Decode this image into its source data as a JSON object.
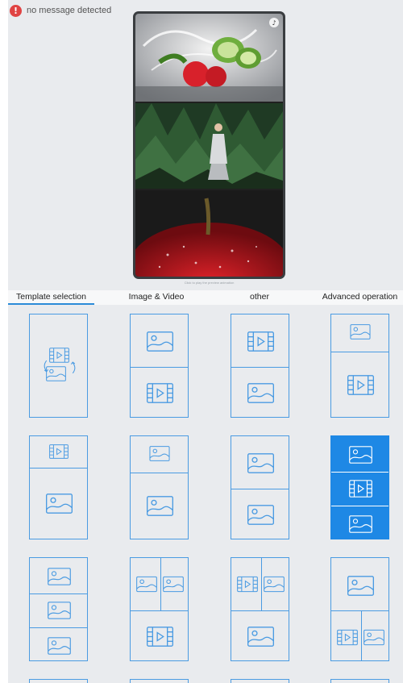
{
  "status": {
    "message": "no message detected",
    "icon": "error-icon",
    "color": "#e04343"
  },
  "preview": {
    "caption": "Click to play the preview animation",
    "panes": [
      "vegetable-splash-photo",
      "woman-in-forest-photo",
      "red-apple-photo"
    ],
    "music_icon": "music-note-icon"
  },
  "tabs": [
    {
      "label": "Template selection",
      "active": true
    },
    {
      "label": "Image & Video",
      "active": false
    },
    {
      "label": "other",
      "active": false
    },
    {
      "label": "Advanced operation",
      "active": false
    }
  ],
  "templates": {
    "accent": "#1e88e5",
    "selected_index": 7,
    "items": [
      {
        "layout": "swap-video-image"
      },
      {
        "layout": "image-over-video"
      },
      {
        "layout": "video-over-image"
      },
      {
        "layout": "image-over-video-small-top"
      },
      {
        "layout": "video-top-small-image-bottom"
      },
      {
        "layout": "image-top-small-image-bottom"
      },
      {
        "layout": "image-over-image"
      },
      {
        "layout": "image-video-image"
      },
      {
        "layout": "image-image-image"
      },
      {
        "layout": "two-images-over-video"
      },
      {
        "layout": "video-image-over-image"
      },
      {
        "layout": "image-over-video-image"
      }
    ]
  }
}
